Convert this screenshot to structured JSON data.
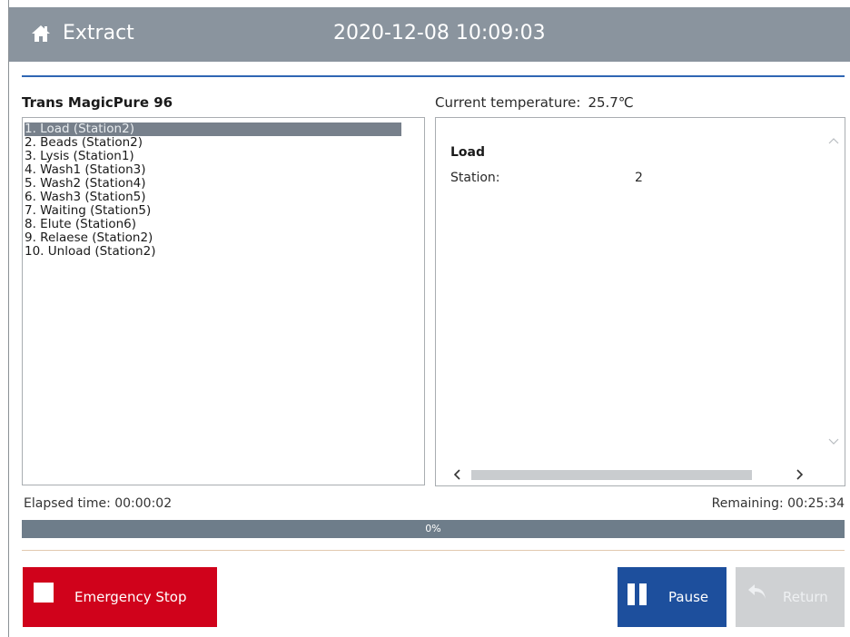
{
  "header": {
    "title": "Extract",
    "datetime": "2020-12-08 10:09:03"
  },
  "program": {
    "name": "Trans MagicPure 96",
    "steps": [
      "1. Load (Station2)",
      "2. Beads (Station2)",
      "3. Lysis (Station1)",
      "4. Wash1 (Station3)",
      "5. Wash2 (Station4)",
      "6. Wash3 (Station5)",
      "7. Waiting (Station5)",
      "8. Elute (Station6)",
      "9. Relaese (Station2)",
      "10. Unload (Station2)"
    ],
    "selected_index": 0
  },
  "temperature": {
    "label": "Current temperature:",
    "value": "25.7℃"
  },
  "detail": {
    "title": "Load",
    "station_label": "Station:",
    "station_value": "2"
  },
  "timing": {
    "elapsed": "Elapsed time: 00:00:02",
    "remaining": "Remaining: 00:25:34"
  },
  "progress": {
    "percent": 0,
    "label": "0%"
  },
  "buttons": {
    "emergency_stop": "Emergency Stop",
    "pause": "Pause",
    "return": "Return"
  },
  "colors": {
    "header_bg": "#8a949e",
    "accent": "#2f66b3",
    "emergency": "#d0021b",
    "pause": "#1d4f9d",
    "disabled": "#cfd1d3",
    "progress_track": "#6e7d8a",
    "selection": "#77808b"
  }
}
